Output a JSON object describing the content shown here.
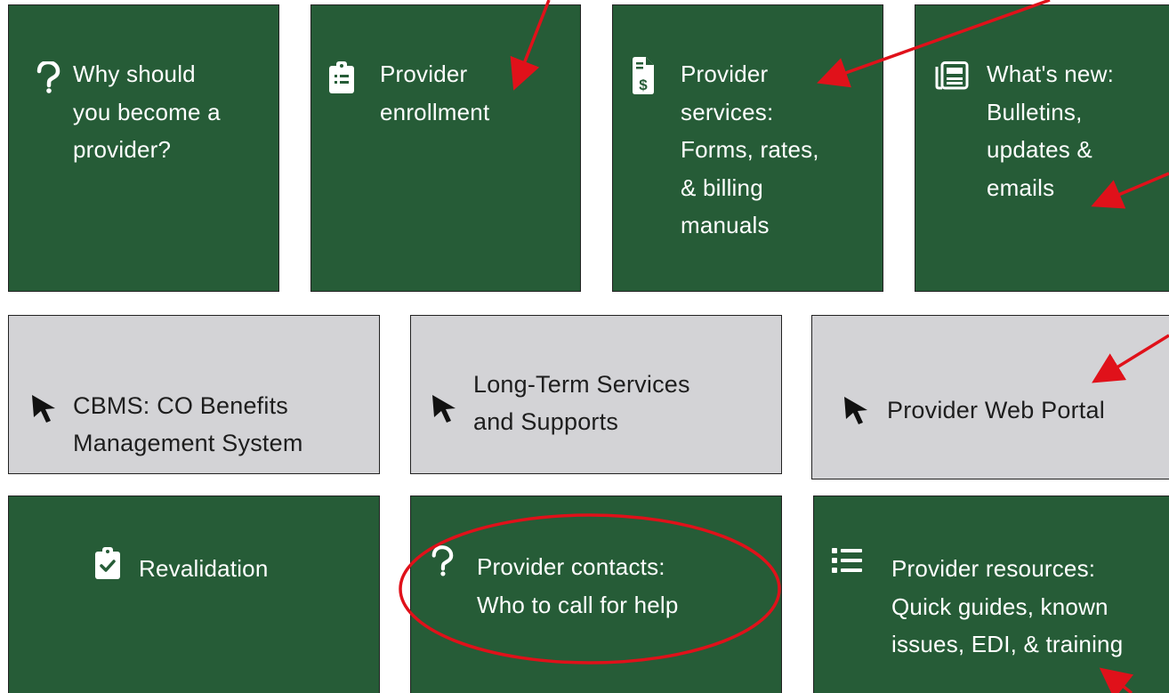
{
  "tiles": {
    "why": {
      "lines": [
        "Why should",
        "you become a",
        "provider?"
      ],
      "icon": "question-icon"
    },
    "enrollment": {
      "lines": [
        "Provider",
        "enrollment"
      ],
      "icon": "clipboard-list-icon"
    },
    "services": {
      "lines": [
        "Provider",
        "services:",
        "Forms, rates,",
        "& billing",
        "manuals"
      ],
      "icon": "invoice-dollar-icon"
    },
    "whats_new": {
      "lines": [
        "What's new:",
        "Bulletins,",
        "updates &",
        "emails"
      ],
      "icon": "newspaper-icon"
    },
    "cbms": {
      "lines": [
        "CBMS: CO Benefits",
        "Management System"
      ],
      "icon": "cursor-icon"
    },
    "ltss": {
      "lines": [
        "Long-Term Services",
        "and Supports"
      ],
      "icon": "cursor-icon"
    },
    "portal": {
      "lines": [
        "Provider Web Portal"
      ],
      "icon": "cursor-icon"
    },
    "revalidation": {
      "lines": [
        "Revalidation"
      ],
      "icon": "clipboard-check-icon"
    },
    "contacts": {
      "lines": [
        "Provider contacts:",
        "Who to call for help"
      ],
      "icon": "question-icon"
    },
    "resources": {
      "lines": [
        "Provider resources:",
        "Quick guides, known",
        "issues, EDI, & training"
      ],
      "icon": "list-icon"
    }
  },
  "colors": {
    "tile_green": "#265c37",
    "tile_grey": "#d3d3d6",
    "annotation_red": "#e0111a"
  }
}
